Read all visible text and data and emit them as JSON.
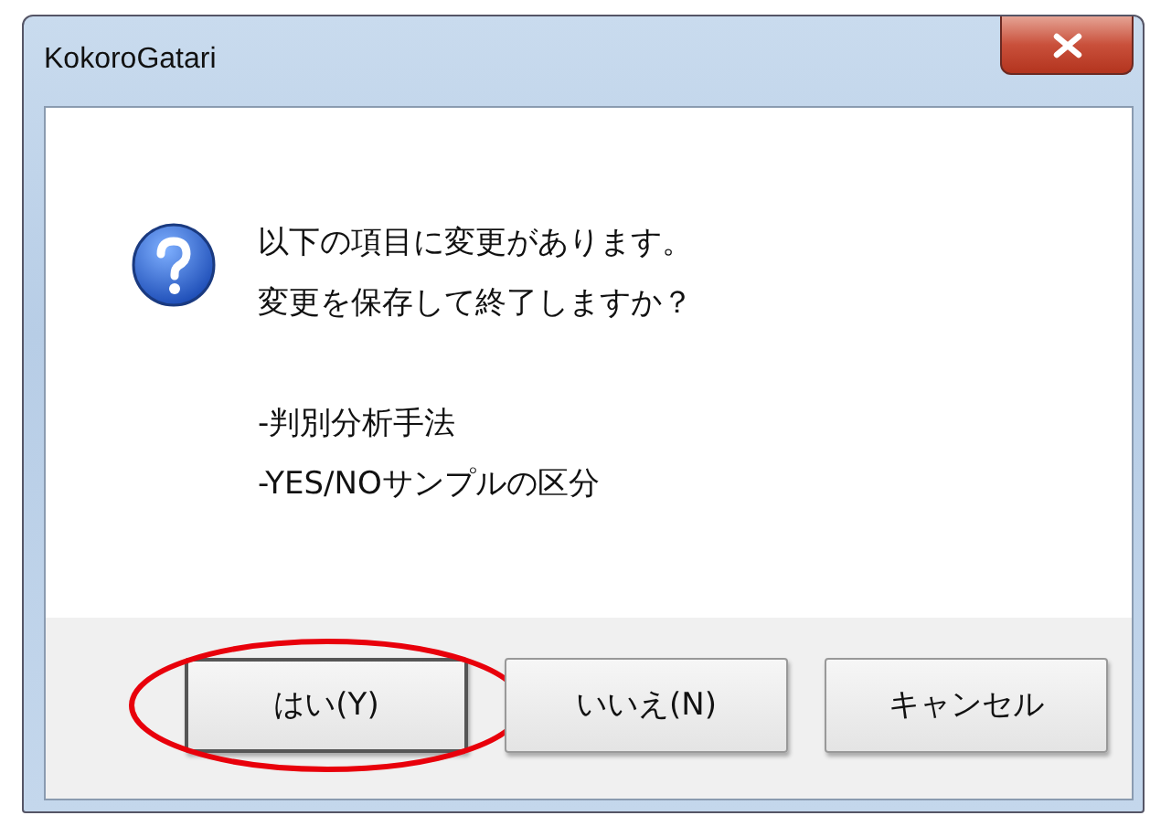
{
  "window": {
    "title": "KokoroGatari"
  },
  "message": {
    "paragraphs": [
      [
        "以下の項目に変更があります。",
        "変更を保存して終了しますか？"
      ],
      [
        "-判別分析手法",
        "-YES/NOサンプルの区分"
      ]
    ]
  },
  "buttons": [
    {
      "label": "はい(Y)",
      "default": true,
      "circled": true
    },
    {
      "label": "いいえ(N)",
      "default": false,
      "circled": false
    },
    {
      "label": "キャンセル",
      "default": false,
      "circled": false
    }
  ]
}
